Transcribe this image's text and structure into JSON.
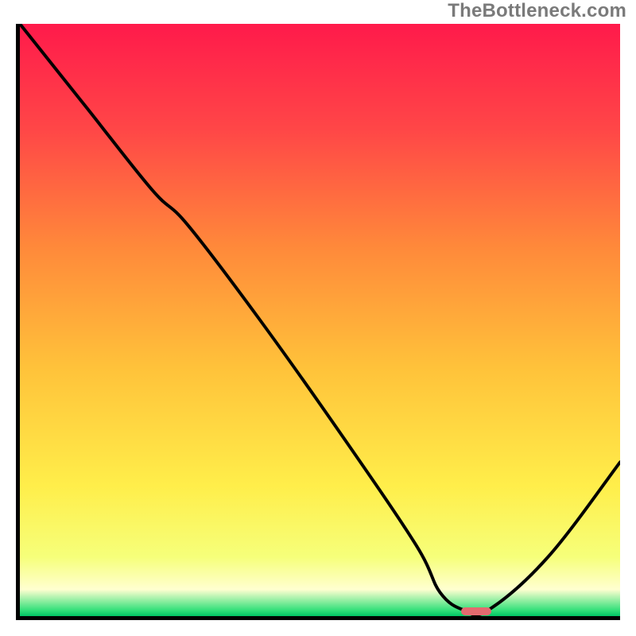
{
  "watermark": "TheBottleneck.com",
  "chart_data": {
    "type": "line",
    "title": "",
    "xlabel": "",
    "ylabel": "",
    "xlim": [
      0,
      100
    ],
    "ylim": [
      0,
      100
    ],
    "grid": false,
    "legend": false,
    "background_gradient_stops": [
      {
        "pos": 0.0,
        "color": "#ff1a4b"
      },
      {
        "pos": 0.18,
        "color": "#ff4747"
      },
      {
        "pos": 0.38,
        "color": "#ff8a3a"
      },
      {
        "pos": 0.58,
        "color": "#ffc23a"
      },
      {
        "pos": 0.78,
        "color": "#ffee4a"
      },
      {
        "pos": 0.9,
        "color": "#f6ff7a"
      },
      {
        "pos": 0.955,
        "color": "#ffffd0"
      },
      {
        "pos": 0.99,
        "color": "#33e07a"
      },
      {
        "pos": 1.0,
        "color": "#00c565"
      }
    ],
    "series": [
      {
        "name": "bottleneck-curve",
        "stroke": "#000000",
        "stroke_width": 3,
        "x": [
          0.0,
          11.0,
          22.0,
          28.0,
          40.0,
          54.0,
          66.0,
          70.0,
          74.0,
          78.0,
          88.0,
          100.0
        ],
        "y": [
          100.0,
          86.0,
          72.0,
          66.0,
          50.0,
          30.0,
          12.0,
          4.0,
          1.0,
          1.0,
          10.0,
          26.0
        ]
      }
    ],
    "marker": {
      "name": "optimal-range-marker",
      "x_start": 73.5,
      "x_end": 78.5,
      "y": 0.2,
      "height": 1.2,
      "color": "#e46a6f"
    }
  }
}
